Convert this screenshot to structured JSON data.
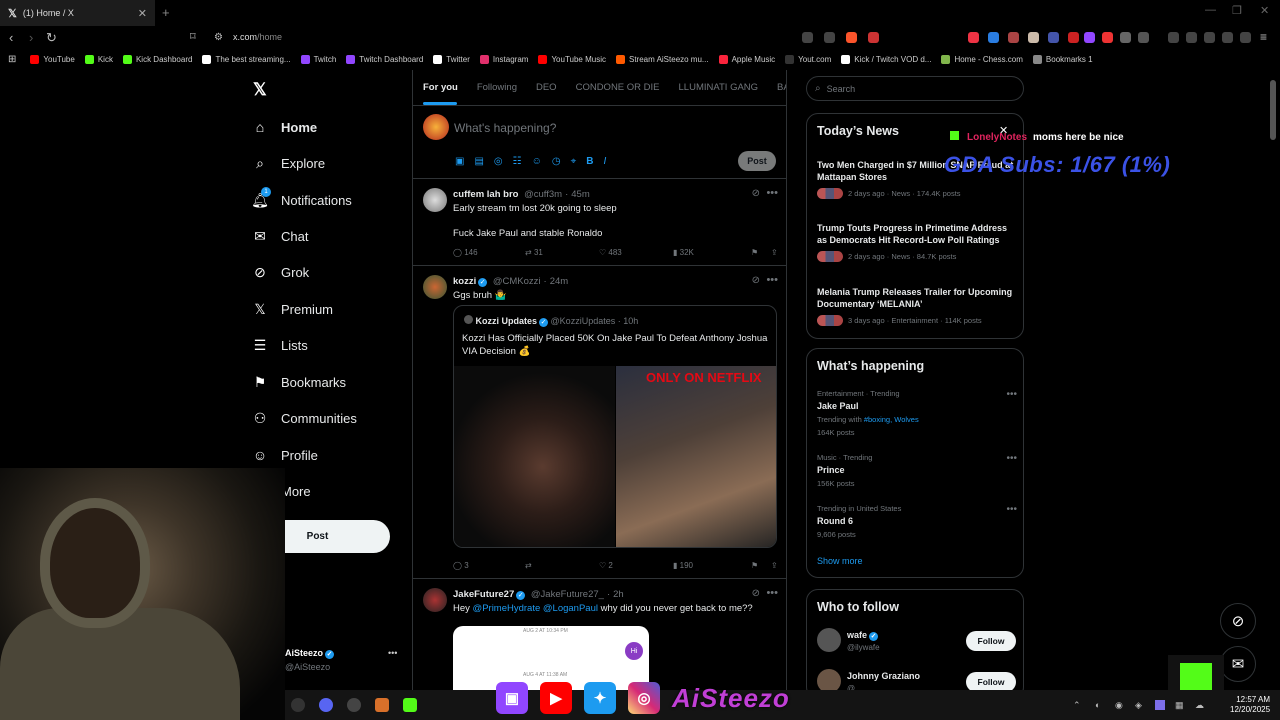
{
  "browser": {
    "tab_title": "(1) Home / X",
    "url_host": "x.com",
    "url_path": "/home",
    "bookmarks": [
      {
        "label": "YouTube",
        "color": "#ff0000"
      },
      {
        "label": "Kick",
        "color": "#53fc18"
      },
      {
        "label": "Kick Dashboard",
        "color": "#53fc18"
      },
      {
        "label": "The best streaming...",
        "color": "#ffffff"
      },
      {
        "label": "Twitch",
        "color": "#9146ff"
      },
      {
        "label": "Twitch Dashboard",
        "color": "#9146ff"
      },
      {
        "label": "Twitter",
        "color": "#ffffff"
      },
      {
        "label": "Instagram",
        "color": "#e1306c"
      },
      {
        "label": "YouTube Music",
        "color": "#ff0000"
      },
      {
        "label": "Stream AiSteezo mu...",
        "color": "#ff5a00"
      },
      {
        "label": "Apple Music",
        "color": "#fa243c"
      },
      {
        "label": "Yout.com",
        "color": "#333333"
      },
      {
        "label": "Kick / Twitch VOD d...",
        "color": "#ffffff"
      },
      {
        "label": "Home - Chess.com",
        "color": "#81b64c"
      },
      {
        "label": "Bookmarks 1",
        "color": "#888888"
      }
    ]
  },
  "nav": {
    "items": [
      {
        "label": "Home",
        "icon": "home-icon"
      },
      {
        "label": "Explore",
        "icon": "search-icon"
      },
      {
        "label": "Notifications",
        "icon": "bell-icon"
      },
      {
        "label": "Chat",
        "icon": "mail-icon"
      },
      {
        "label": "Grok",
        "icon": "grok-icon"
      },
      {
        "label": "Premium",
        "icon": "x-icon"
      },
      {
        "label": "Lists",
        "icon": "list-icon"
      },
      {
        "label": "Bookmarks",
        "icon": "bookmark-icon"
      },
      {
        "label": "Communities",
        "icon": "people-icon"
      },
      {
        "label": "Profile",
        "icon": "person-icon"
      },
      {
        "label": "More",
        "icon": "more-icon"
      }
    ],
    "post_label": "Post",
    "profile_name": "AiSteezo",
    "profile_handle": "@AiSteezo",
    "notification_badge": "1"
  },
  "feed": {
    "tabs": [
      "For you",
      "Following",
      "DEO",
      "CONDONE OR DIE",
      "LLUMINATI GANG",
      "BAU"
    ],
    "compose_placeholder": "What's happening?",
    "compose_post": "Post",
    "tweets": [
      {
        "name": "cuffem lah bro",
        "handle": "@cuff3m",
        "time": "45m",
        "line1": "Early stream tm lost 20k going to sleep",
        "line2": "Fuck Jake Paul and stable Ronaldo",
        "replies": "146",
        "reposts": "31",
        "likes": "483",
        "views": "32K"
      },
      {
        "name": "kozzi",
        "handle": "@CMKozzi",
        "time": "24m",
        "line1": "Ggs bruh 🤷‍♂️",
        "quote_name": "Kozzi Updates",
        "quote_handle": "@KozziUpdates",
        "quote_time": "10h",
        "quote_text": "Kozzi Has Officially Placed 50K On Jake Paul To Defeat Anthony Joshua VIA Decision 💰",
        "quote_image_text": "ONLY ON NETFLIX",
        "replies": "3",
        "reposts": "",
        "likes": "2",
        "views": "190"
      },
      {
        "name": "JakeFuture27",
        "handle": "@JakeFuture27_",
        "time": "2h",
        "line1_pre": "Hey ",
        "mention1": "@PrimeHydrate",
        "mention2": "@LoganPaul",
        "line1_post": " why did you never get back to me??",
        "dm_date1": "AUG 2 AT 10:34 PM",
        "dm_date2": "AUG 4 AT 11:38 AM",
        "dm_hi": "Hi"
      }
    ]
  },
  "right": {
    "search_placeholder": "Search",
    "news_title": "Today’s News",
    "news": [
      {
        "title": "Two Men Charged in $7 Million SNAP Fraud at Mattapan Stores",
        "meta": "2 days ago · News · 174.4K posts"
      },
      {
        "title": "Trump Touts Progress in Primetime Address as Democrats Hit Record-Low Poll Ratings",
        "meta": "2 days ago · News · 84.7K posts"
      },
      {
        "title": "Melania Trump Releases Trailer for Upcoming Documentary ‘MELANIA’",
        "meta": "3 days ago · Entertainment · 114K posts"
      }
    ],
    "happening_title": "What’s happening",
    "trends": [
      {
        "cat": "Entertainment · Trending",
        "name": "Jake Paul",
        "with_label": "Trending with ",
        "with": "#boxing, Wolves",
        "count": "164K posts"
      },
      {
        "cat": "Music · Trending",
        "name": "Prince",
        "count": "156K posts"
      },
      {
        "cat": "Trending in United States",
        "name": "Round 6",
        "count": "9,606 posts"
      }
    ],
    "show_more": "Show more",
    "follow_title": "Who to follow",
    "follows": [
      {
        "name": "wafe",
        "handle": "@ilywafe",
        "button": "Follow"
      },
      {
        "name": "Johnny Graziano",
        "handle": "@...",
        "button": "Follow"
      }
    ]
  },
  "overlay": {
    "alert_user": "LonelyNotes",
    "alert_msg": "moms here be nice",
    "subs": "GDA Subs: 1/67 (1%)",
    "brand": "AiSteezo"
  },
  "taskbar": {
    "time": "12:57 AM",
    "date": "12/20/2025"
  }
}
